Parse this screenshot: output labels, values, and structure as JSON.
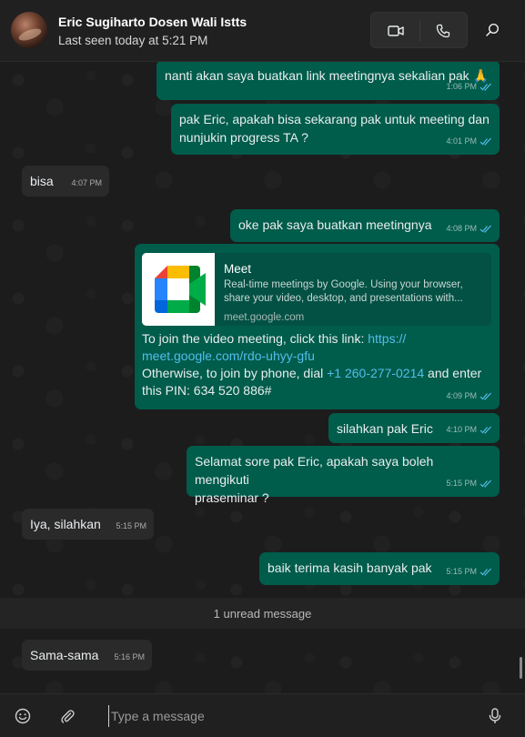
{
  "header": {
    "contact_name": "Eric Sugiharto Dosen Wali Istts",
    "last_seen": "Last seen today at 5:21 PM",
    "icons": [
      "video-call-icon",
      "voice-call-icon",
      "search-icon"
    ]
  },
  "messages": [
    {
      "direction": "out",
      "text": "nanti akan saya buatkan link meetingnya sekalian pak 🙏",
      "time": "1:06 PM",
      "status": "read"
    },
    {
      "direction": "out",
      "text": "pak Eric, apakah bisa sekarang pak untuk meeting dan\nnunjukin progress TA ?",
      "time": "4:01 PM",
      "status": "read"
    },
    {
      "direction": "in",
      "text": "bisa",
      "time": "4:07 PM"
    },
    {
      "direction": "out",
      "text": "oke pak saya buatkan meetingnya",
      "time": "4:08 PM",
      "status": "read"
    },
    {
      "direction": "out",
      "link_preview": {
        "title": "Meet",
        "description": "Real-time meetings by Google. Using your browser, share your video, desktop, and presentations with...",
        "domain": "meet.google.com"
      },
      "text_before_link": "To join the video meeting, click this link: ",
      "link": "https://\nmeet.google.com/rdo-uhyy-gfu",
      "text_before_phone": "Otherwise, to join by phone, dial ",
      "phone": "+1 260-277-0214",
      "text_after_phone": " and enter\nthis PIN: 634 520 886#",
      "time": "4:09 PM",
      "status": "read"
    },
    {
      "direction": "out",
      "text": "silahkan pak Eric",
      "time": "4:10 PM",
      "status": "read"
    },
    {
      "direction": "out",
      "text": "Selamat sore pak Eric, apakah saya boleh mengikuti\npraseminar ?",
      "time": "5:15 PM",
      "status": "read"
    },
    {
      "direction": "in",
      "text": "Iya, silahkan",
      "time": "5:15 PM"
    },
    {
      "direction": "out",
      "text": "baik terima kasih banyak pak",
      "time": "5:15 PM",
      "status": "read"
    },
    {
      "direction": "in",
      "text": "Sama-sama",
      "time": "5:16 PM"
    }
  ],
  "unread_divider": "1 unread message",
  "composer": {
    "placeholder": "Type a message",
    "icons": [
      "emoji-icon",
      "attach-icon",
      "mic-icon"
    ]
  },
  "colors": {
    "outgoing_bubble": "#005c4b",
    "incoming_bubble": "#2a2a2a",
    "read_tick": "#53bdeb",
    "link": "#53bdeb"
  }
}
